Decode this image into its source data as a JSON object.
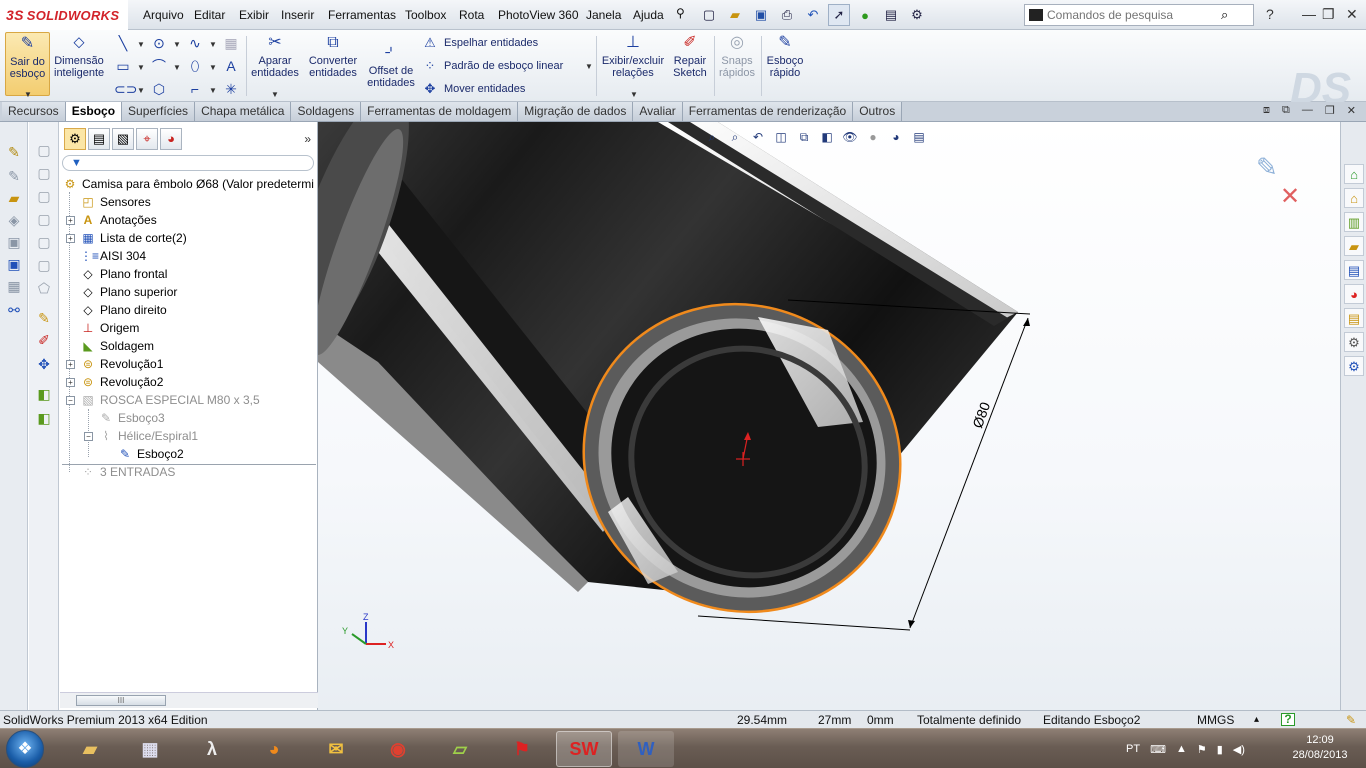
{
  "app": {
    "logo_text": "SOLIDWORKS",
    "logo_mark": "3S"
  },
  "menu": [
    "Arquivo",
    "Editar",
    "Exibir",
    "Inserir",
    "Ferramentas",
    "Toolbox",
    "Rota",
    "PhotoView 360",
    "Janela",
    "Ajuda"
  ],
  "search": {
    "placeholder": "Comandos de pesquisa"
  },
  "ribbon": {
    "sair": "Sair do esboço",
    "dimensao": "Dimensão inteligente",
    "aparar": "Aparar entidades",
    "converter": "Converter entidades",
    "offset": "Offset de entidades",
    "espelhar": "Espelhar entidades",
    "padrao": "Padrão de esboço linear",
    "mover": "Mover entidades",
    "exibir": "Exibir/excluir relações",
    "repair": "Repair Sketch",
    "snaps": "Snaps rápidos",
    "esboco_rapido": "Esboço rápido"
  },
  "tabs": [
    "Recursos",
    "Esboço",
    "Superfícies",
    "Chapa metálica",
    "Soldagens",
    "Ferramentas de moldagem",
    "Migração de dados",
    "Avaliar",
    "Ferramentas de renderização",
    "Outros"
  ],
  "active_tab": "Esboço",
  "tree": {
    "root": "Camisa para êmbolo Ø68  (Valor predetermi",
    "items": [
      "Sensores",
      "Anotações",
      "Lista de corte(2)",
      "AISI 304",
      "Plano frontal",
      "Plano superior",
      "Plano direito",
      "Origem",
      "Soldagem",
      "Revolução1",
      "Revolução2",
      "ROSCA ESPECIAL M80 x 3,5",
      "Esboço3",
      "Hélice/Espiral1",
      "Esboço2",
      "3 ENTRADAS"
    ]
  },
  "viewport": {
    "dimension": "Ø80",
    "triad_x": "X",
    "triad_y": "Y",
    "triad_z": "Z",
    "accent": "#f08a1c"
  },
  "status": {
    "edition": "SolidWorks Premium 2013 x64 Edition",
    "x": "29.54mm",
    "y": "27mm",
    "z": "0mm",
    "state": "Totalmente definido",
    "editing": "Editando Esboço2",
    "units": "MMGS",
    "help": "?"
  },
  "taskbar": {
    "lang": "PT",
    "time": "12:09",
    "date": "28/08/2013"
  }
}
